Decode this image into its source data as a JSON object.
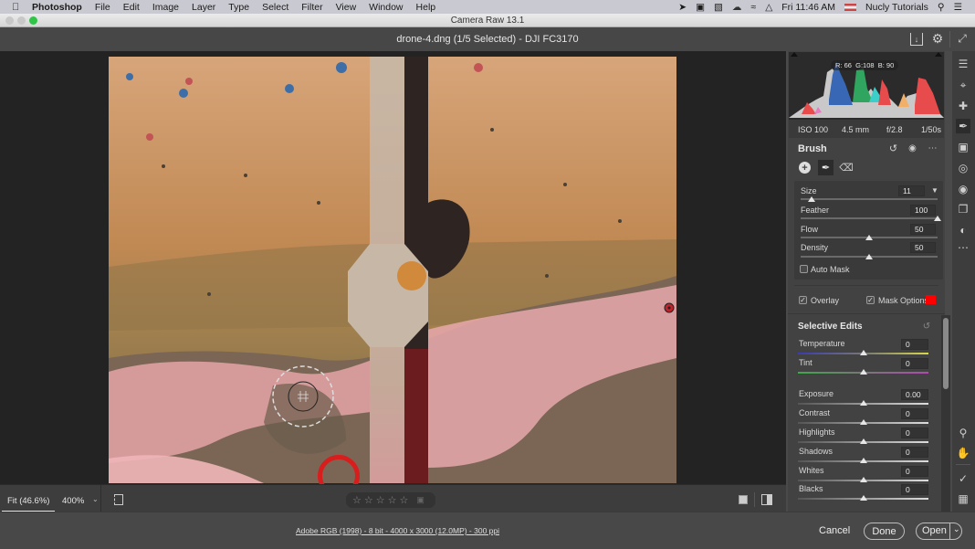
{
  "menubar": {
    "app": "Photoshop",
    "items": [
      "File",
      "Edit",
      "Image",
      "Layer",
      "Type",
      "Select",
      "Filter",
      "View",
      "Window",
      "Help"
    ],
    "clock": "Fri 11:46 AM",
    "user": "Nucly Tutorials"
  },
  "window": {
    "title": "Camera Raw 13.1"
  },
  "document": {
    "title": "drone-4.dng (1/5 Selected)  -  DJI FC3170"
  },
  "histogram": {
    "r_label": "R:",
    "r": "66",
    "g_label": "G:",
    "g": "108",
    "b_label": "B:",
    "b": "90"
  },
  "exif": {
    "iso": "ISO 100",
    "focal": "4.5 mm",
    "aperture": "f/2.8",
    "shutter": "1/50s"
  },
  "brush": {
    "title": "Brush",
    "size": {
      "label": "Size",
      "value": "11",
      "fraction": 0.08
    },
    "feather": {
      "label": "Feather",
      "value": "100",
      "fraction": 1.0
    },
    "flow": {
      "label": "Flow",
      "value": "50",
      "fraction": 0.5
    },
    "density": {
      "label": "Density",
      "value": "50",
      "fraction": 0.5
    },
    "auto_mask": {
      "label": "Auto Mask",
      "checked": false
    },
    "overlay": {
      "label": "Overlay",
      "checked": true
    },
    "mask_options": {
      "label": "Mask Options",
      "color": "#ff0000",
      "checked": true
    }
  },
  "selective_edits": {
    "title": "Selective Edits",
    "sliders": [
      {
        "label": "Temperature",
        "value": "0",
        "fraction": 0.5
      },
      {
        "label": "Tint",
        "value": "0",
        "fraction": 0.5
      },
      {
        "label": "Exposure",
        "value": "0.00",
        "fraction": 0.5
      },
      {
        "label": "Contrast",
        "value": "0",
        "fraction": 0.5
      },
      {
        "label": "Highlights",
        "value": "0",
        "fraction": 0.5
      },
      {
        "label": "Shadows",
        "value": "0",
        "fraction": 0.5
      },
      {
        "label": "Whites",
        "value": "0",
        "fraction": 0.5
      },
      {
        "label": "Blacks",
        "value": "0",
        "fraction": 0.5
      }
    ]
  },
  "bottom_strip": {
    "fit": "Fit (46.6%)",
    "zoom": "400%",
    "rating_stars": 0
  },
  "footer": {
    "info": "Adobe RGB (1998) - 8 bit - 4000 x 3000 (12.0MP) - 300 ppi",
    "cancel": "Cancel",
    "done": "Done",
    "open": "Open"
  },
  "check_glyph": "✓",
  "star_glyph": "☆"
}
